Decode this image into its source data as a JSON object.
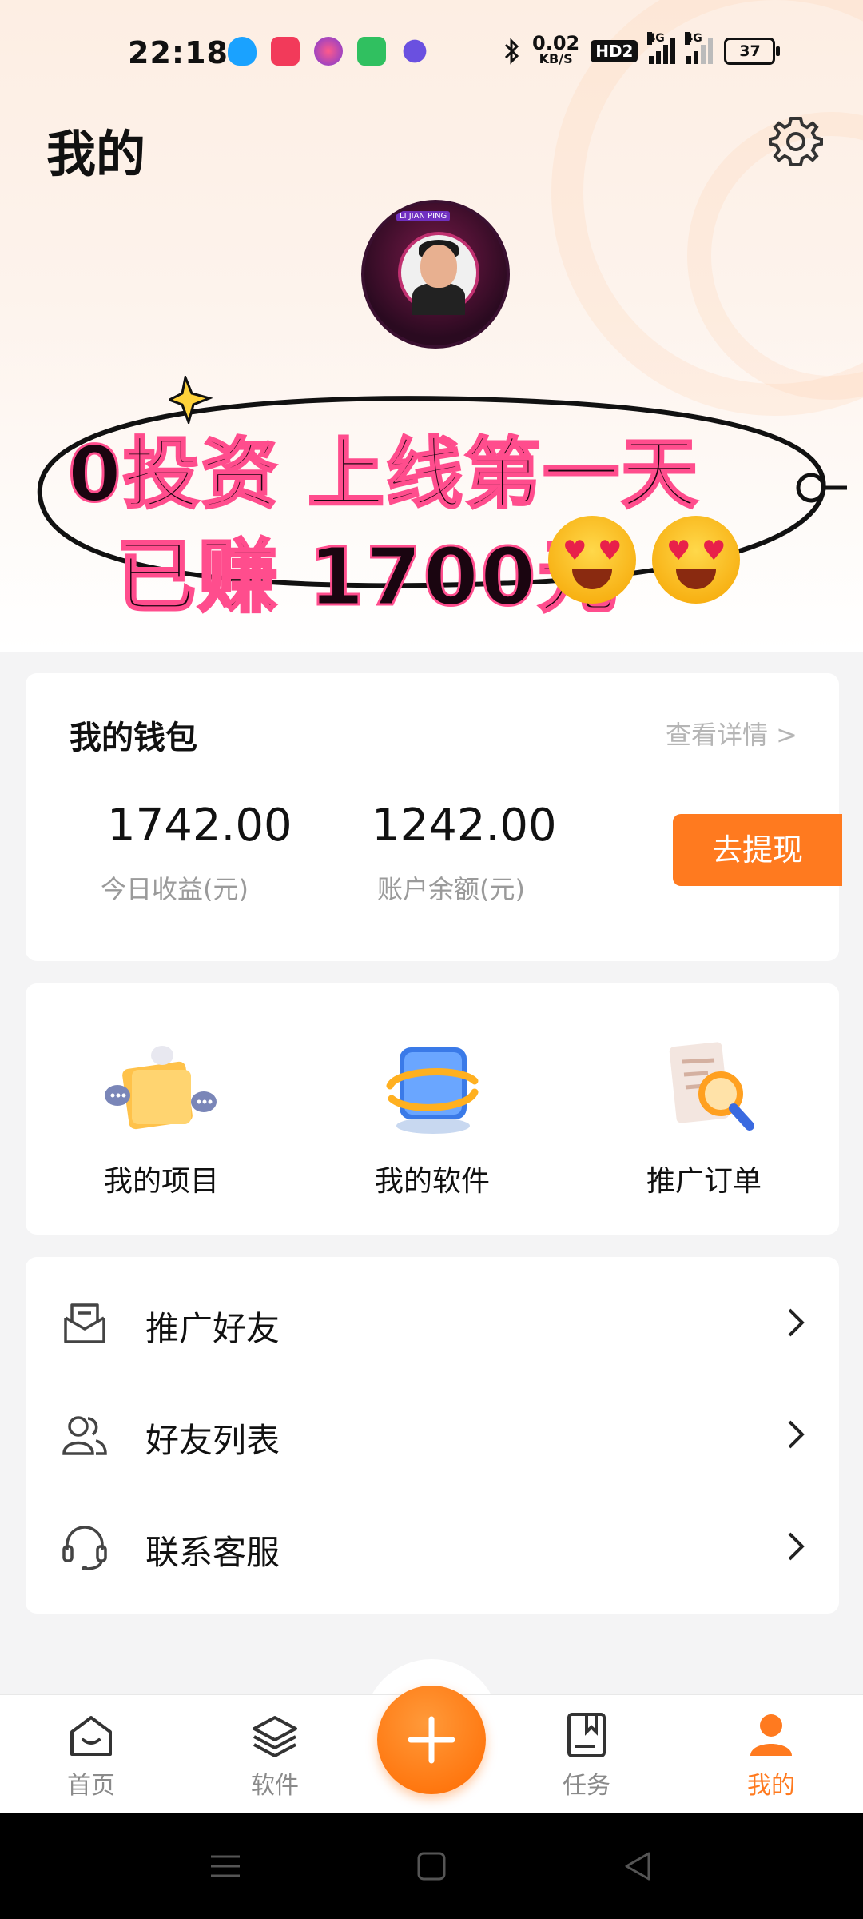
{
  "status_bar": {
    "time": "22:18",
    "net_speed_value": "0.02",
    "net_speed_unit": "KB/S",
    "hd_label": "HD2",
    "signal1_label": "4G",
    "signal2_label": "4G",
    "battery": "37",
    "notification_icons": [
      "qq-icon",
      "video-icon",
      "app-icon",
      "store-icon",
      "chat-icon"
    ]
  },
  "header": {
    "title": "我的",
    "settings_icon": "gear-icon"
  },
  "banner": {
    "line1": "0投资  上线第一天",
    "line2": "已赚 1700元"
  },
  "wallet": {
    "title": "我的钱包",
    "detail_link": "查看详情 >",
    "today_earnings": "1742.00",
    "today_earnings_label": "今日收益(元)",
    "balance": "1242.00",
    "balance_label": "账户余额(元)",
    "withdraw_button": "去提现"
  },
  "shortcuts": [
    {
      "label": "我的项目",
      "icon": "folder-icon"
    },
    {
      "label": "我的软件",
      "icon": "software-icon"
    },
    {
      "label": "推广订单",
      "icon": "order-search-icon"
    }
  ],
  "menu": [
    {
      "label": "推广好友",
      "icon": "mail-icon"
    },
    {
      "label": "好友列表",
      "icon": "friends-icon"
    },
    {
      "label": "联系客服",
      "icon": "headset-icon"
    }
  ],
  "tabbar": [
    {
      "label": "首页",
      "icon": "home-icon"
    },
    {
      "label": "软件",
      "icon": "layers-icon"
    },
    {
      "label": "任务",
      "icon": "task-icon"
    },
    {
      "label": "我的",
      "icon": "person-icon",
      "active": true
    }
  ],
  "colors": {
    "accent": "#ff7a1f",
    "muted_text": "#9a9a9a"
  }
}
